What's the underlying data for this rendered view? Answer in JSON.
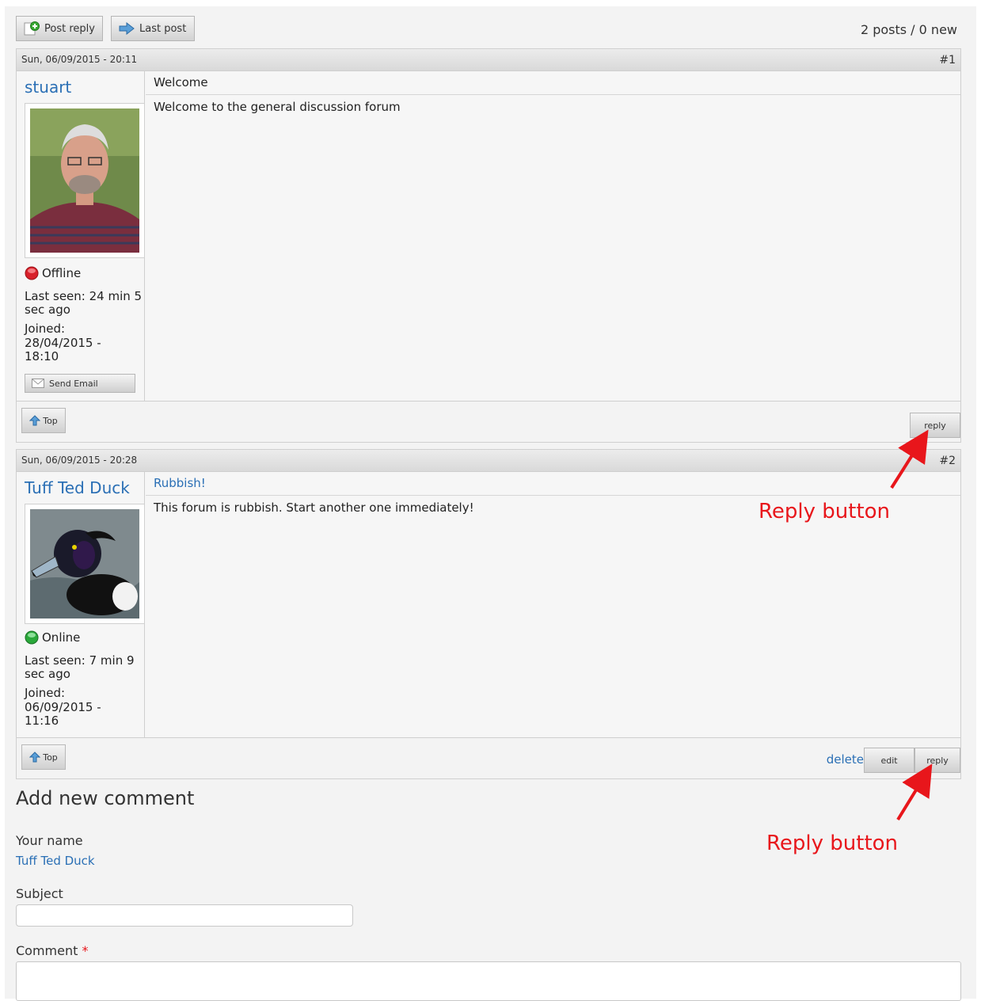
{
  "toolbar": {
    "post_reply_label": "Post reply",
    "last_post_label": "Last post",
    "post_count_text": "2 posts / 0 new"
  },
  "posts": [
    {
      "date": "Sun, 06/09/2015 - 20:11",
      "number": "#1",
      "author": "stuart",
      "status": "Offline",
      "status_color": "#d8202a",
      "last_seen": "Last seen: 24 min 5 sec ago",
      "joined_label": "Joined:",
      "joined_value": "28/04/2015 - 18:10",
      "send_email_label": "Send Email",
      "subject": "Welcome",
      "body": "Welcome to the general discussion forum",
      "top_label": "Top",
      "reply_label": "reply"
    },
    {
      "date": "Sun, 06/09/2015 - 20:28",
      "number": "#2",
      "author": "Tuff Ted Duck",
      "status": "Online",
      "status_color": "#2aa83a",
      "last_seen": "Last seen: 7 min 9 sec ago",
      "joined_label": "Joined:",
      "joined_value": "06/09/2015 - 11:16",
      "subject": "Rubbish!",
      "body": "This forum is rubbish. Start another one immediately!",
      "top_label": "Top",
      "delete_label": "delete",
      "edit_label": "edit",
      "reply_label": "reply"
    }
  ],
  "annotations": {
    "label_1": "Reply button",
    "label_2": "Reply button",
    "color": "#e8161b"
  },
  "comment_form": {
    "title": "Add new comment",
    "your_name_label": "Your name",
    "your_name_value": "Tuff Ted Duck",
    "subject_label": "Subject",
    "subject_value": "",
    "comment_label": "Comment",
    "required_mark": "*",
    "comment_value": ""
  },
  "colors": {
    "link": "#2a6fb5",
    "page_bg": "#f3f3f3",
    "header_bg": "#dcdcdc"
  }
}
